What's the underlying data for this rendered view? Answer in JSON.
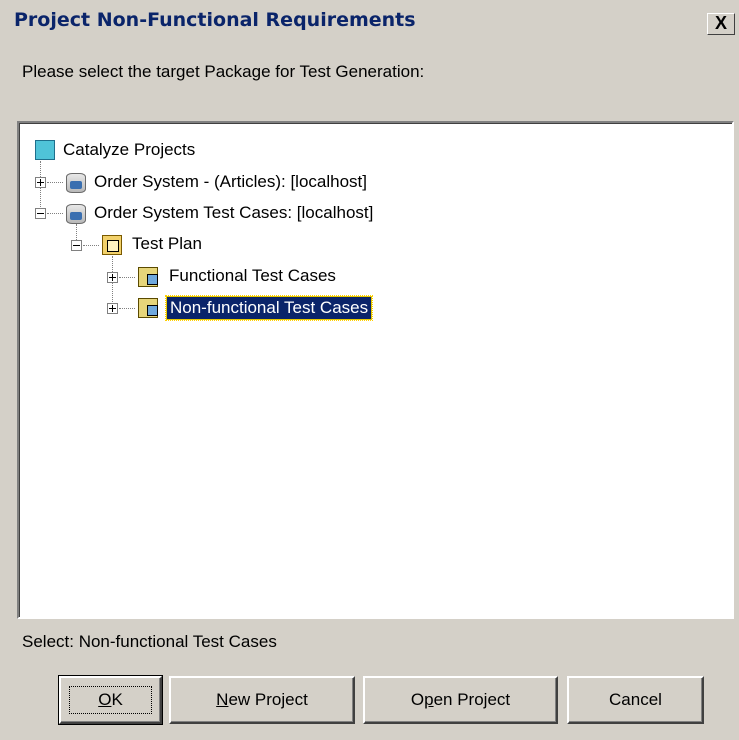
{
  "dialog": {
    "title": "Project Non-Functional Requirements",
    "close_glyph": "X",
    "prompt": "Please select the target Package for Test Generation:"
  },
  "tree": {
    "root": {
      "label": "Catalyze Projects",
      "icon": "project-icon"
    },
    "items": [
      {
        "label": "Order System - (Articles): [localhost]",
        "icon": "database-icon",
        "expanded": false
      },
      {
        "label": "Order System Test Cases: [localhost]",
        "icon": "database-icon",
        "expanded": true
      },
      {
        "label": "Test Plan",
        "icon": "package-icon",
        "expanded": true
      },
      {
        "label": "Functional Test Cases",
        "icon": "test-case-package-icon",
        "expanded": false
      },
      {
        "label": "Non-functional Test Cases",
        "icon": "test-case-package-icon",
        "expanded": false,
        "selected": true
      }
    ]
  },
  "status": {
    "text": "Select: Non-functional Test Cases"
  },
  "buttons": {
    "ok": {
      "mnemonic": "O",
      "rest": "K"
    },
    "new_project": {
      "mnemonic": "N",
      "rest": "ew Project"
    },
    "open_project": {
      "pre": "O",
      "mnemonic": "p",
      "rest": "en Project"
    },
    "cancel": {
      "label": "Cancel"
    }
  },
  "colors": {
    "title_text": "#0a246a",
    "selection_bg": "#0a246a",
    "dialog_bg": "#d4d0c8"
  }
}
